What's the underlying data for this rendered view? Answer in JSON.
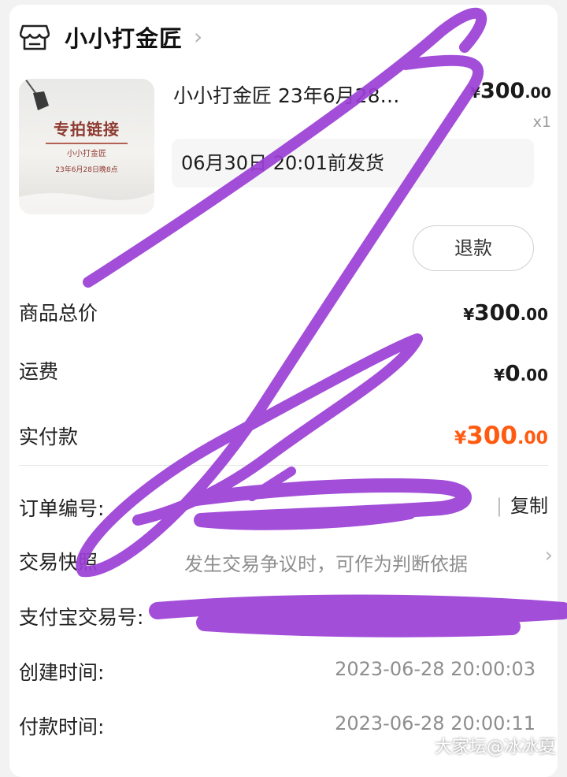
{
  "shop": {
    "name": "小小打金匠",
    "icon": "shop-icon"
  },
  "product": {
    "title": "小小打金匠 23年6月28…",
    "thumb_title": "专拍链接",
    "thumb_shop": "小小打金匠",
    "thumb_date": "23年6月28日晚8点",
    "price_symbol": "¥",
    "price_int": "300",
    "price_dec": ".00",
    "qty": "x1",
    "ship_deadline": "06月30日 20:01前发货",
    "refund_label": "退款"
  },
  "summary": {
    "goods_total_label": "商品总价",
    "goods_total_int": "300",
    "goods_total_dec": ".00",
    "freight_label": "运费",
    "freight_int": "0",
    "freight_dec": ".00",
    "paid_label": "实付款",
    "paid_int": "300",
    "paid_dec": ".00",
    "currency": "¥"
  },
  "details": {
    "order_no_label": "订单编号:",
    "copy_label": "复制",
    "snapshot_label": "交易快照",
    "snapshot_value": "发生交易争议时，可作为判断依据",
    "alipay_label": "支付宝交易号:",
    "created_label": "创建时间:",
    "created_value": "2023-06-28 20:00:03",
    "paid_time_label": "付款时间:",
    "paid_time_value": "2023-06-28 20:00:11"
  },
  "watermark": "大家坛@冰冰夏",
  "colors": {
    "accent": "#ff5a10",
    "scribble": "#9b3fd6"
  }
}
